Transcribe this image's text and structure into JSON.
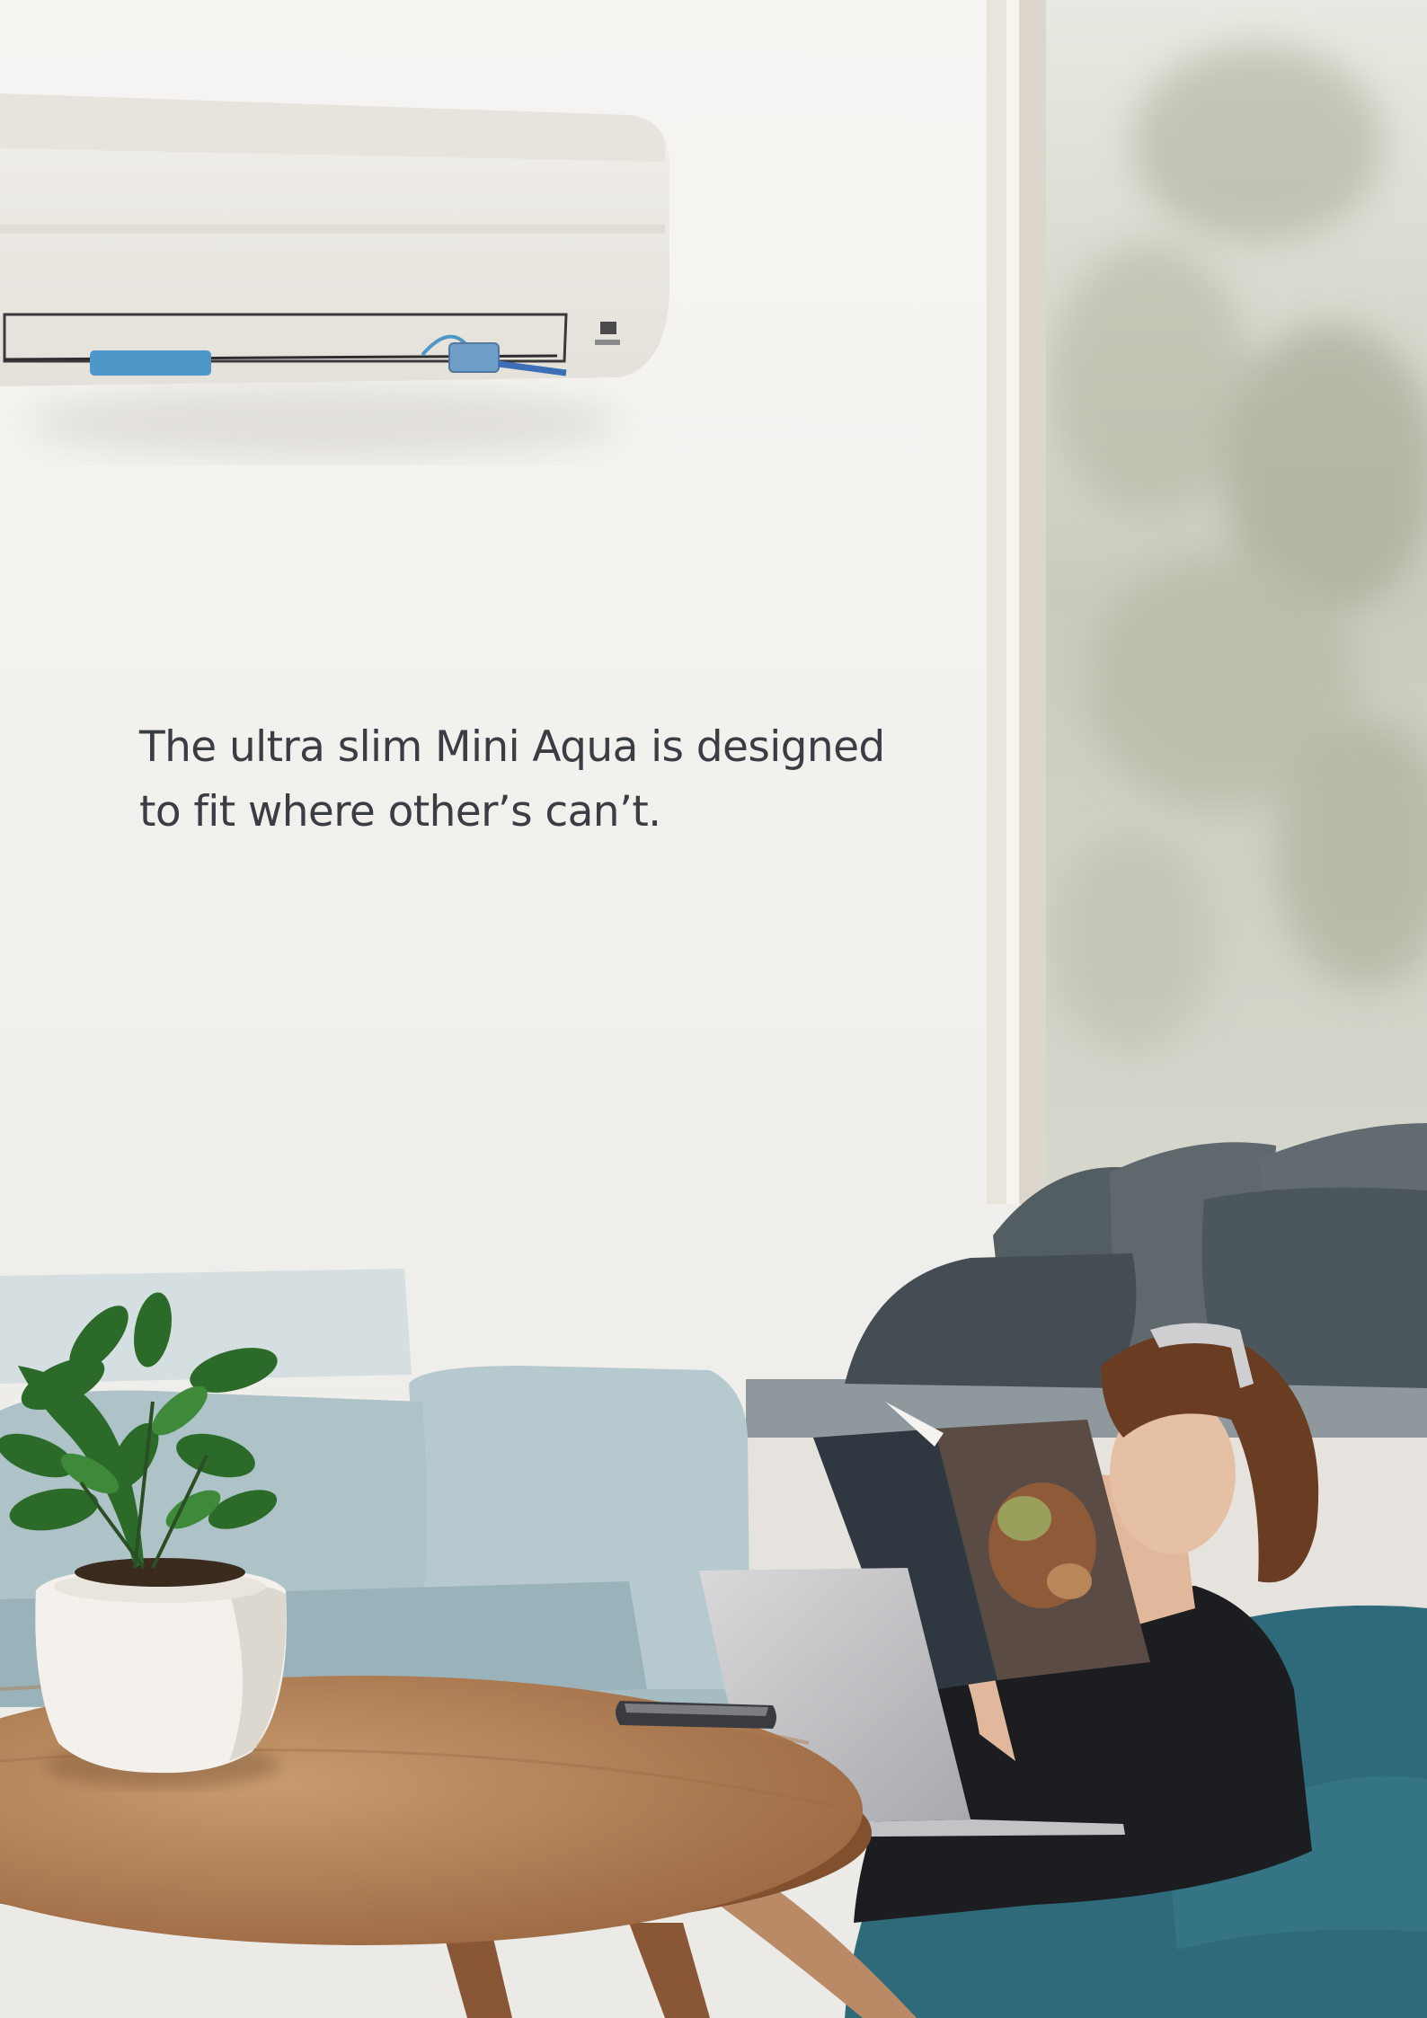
{
  "headline": {
    "line1": "The ultra slim Mini Aqua is designed",
    "line2": "to fit where other’s can’t."
  },
  "colors": {
    "wall": "#f2f1ee",
    "headline_text": "#3b3d45",
    "sofa": "#a9c2c8",
    "table_wood": "#a5724a",
    "beanbag": "#2e6a7a"
  }
}
